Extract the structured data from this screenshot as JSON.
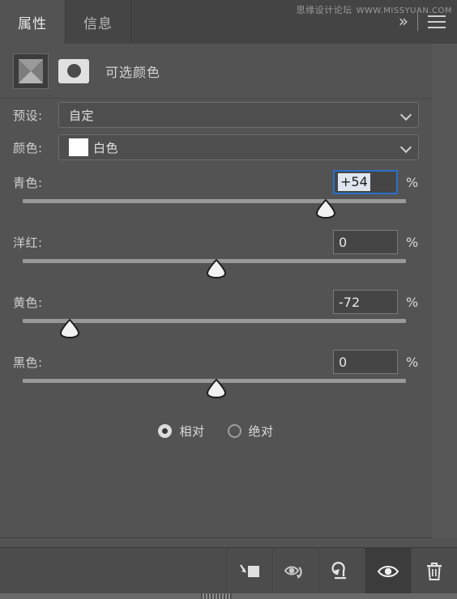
{
  "window": {
    "tabs": [
      {
        "label": "属性",
        "name": "tab-properties",
        "active": true
      },
      {
        "label": "信息",
        "name": "tab-info",
        "active": false
      }
    ],
    "collapse_icon": "double-chevron-right-icon",
    "menu_icon": "hamburger-menu-icon",
    "watermark_cn": "思缘设计论坛",
    "watermark_en": "WWW.MISSYUAN.COM"
  },
  "adjustment": {
    "title": "可选颜色",
    "layer_icon": "selective-color-adjustment-icon",
    "mask_icon": "layer-mask-thumbnail-icon"
  },
  "preset": {
    "label": "预设:",
    "value": "自定"
  },
  "color": {
    "label": "颜色:",
    "value": "白色",
    "swatch_hex": "#ffffff"
  },
  "sliders": [
    {
      "name": "cyan",
      "label": "青色:",
      "value": "+54",
      "unit": "%",
      "percent": 77,
      "focused": true
    },
    {
      "name": "magenta",
      "label": "洋红:",
      "value": "0",
      "unit": "%",
      "percent": 50,
      "focused": false
    },
    {
      "name": "yellow",
      "label": "黄色:",
      "value": "-72",
      "unit": "%",
      "percent": 14,
      "focused": false
    },
    {
      "name": "black",
      "label": "黑色:",
      "value": "0",
      "unit": "%",
      "percent": 50,
      "focused": false
    }
  ],
  "method": {
    "options": [
      {
        "label": "相对",
        "name": "radio-relative",
        "selected": true
      },
      {
        "label": "绝对",
        "name": "radio-absolute",
        "selected": false
      }
    ]
  },
  "toolbar": {
    "buttons": [
      {
        "name": "clip-to-layer-icon",
        "active": false
      },
      {
        "name": "toggle-previous-state-icon",
        "active": false
      },
      {
        "name": "reset-icon",
        "active": false
      },
      {
        "name": "visibility-eye-icon",
        "active": true
      },
      {
        "name": "delete-trash-icon",
        "active": false
      }
    ]
  },
  "colors": {
    "panel_bg": "#535353",
    "tab_bg": "#444444",
    "focus_blue": "#2a6fc9",
    "track": "#9a9a9a"
  }
}
